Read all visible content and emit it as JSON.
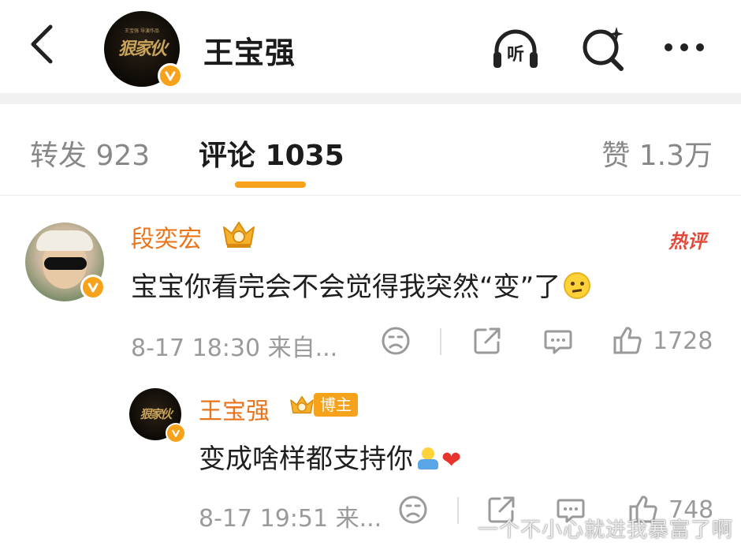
{
  "header": {
    "title": "王宝强",
    "avatar_text": "狠家伙",
    "avatar_small_text": "王宝强 导演作品",
    "listen_label": "听"
  },
  "tabs": {
    "repost": "转发 923",
    "comment": "评论 1035",
    "like": "赞 1.3万",
    "active": "comment"
  },
  "comment": {
    "user": "段奕宏",
    "hot_label": "热评",
    "text": "宝宝你看完会不会觉得我突然“变”了",
    "emoji": "thinking-face",
    "meta": "8-17 18:30 来自...",
    "like_count": "1728"
  },
  "reply": {
    "user": "王宝强",
    "badge": "博主",
    "text": "变成啥样都支持你",
    "emoji": "person-emoji",
    "heart": "❤",
    "meta": "8-17 19:51 来...",
    "like_count": "748"
  },
  "watermark": "一个不小心就进我暴富了啊",
  "colors": {
    "accent": "#f8a21b",
    "username": "#e9741c",
    "hot": "#e14a3a",
    "muted": "#9a9a9a"
  }
}
